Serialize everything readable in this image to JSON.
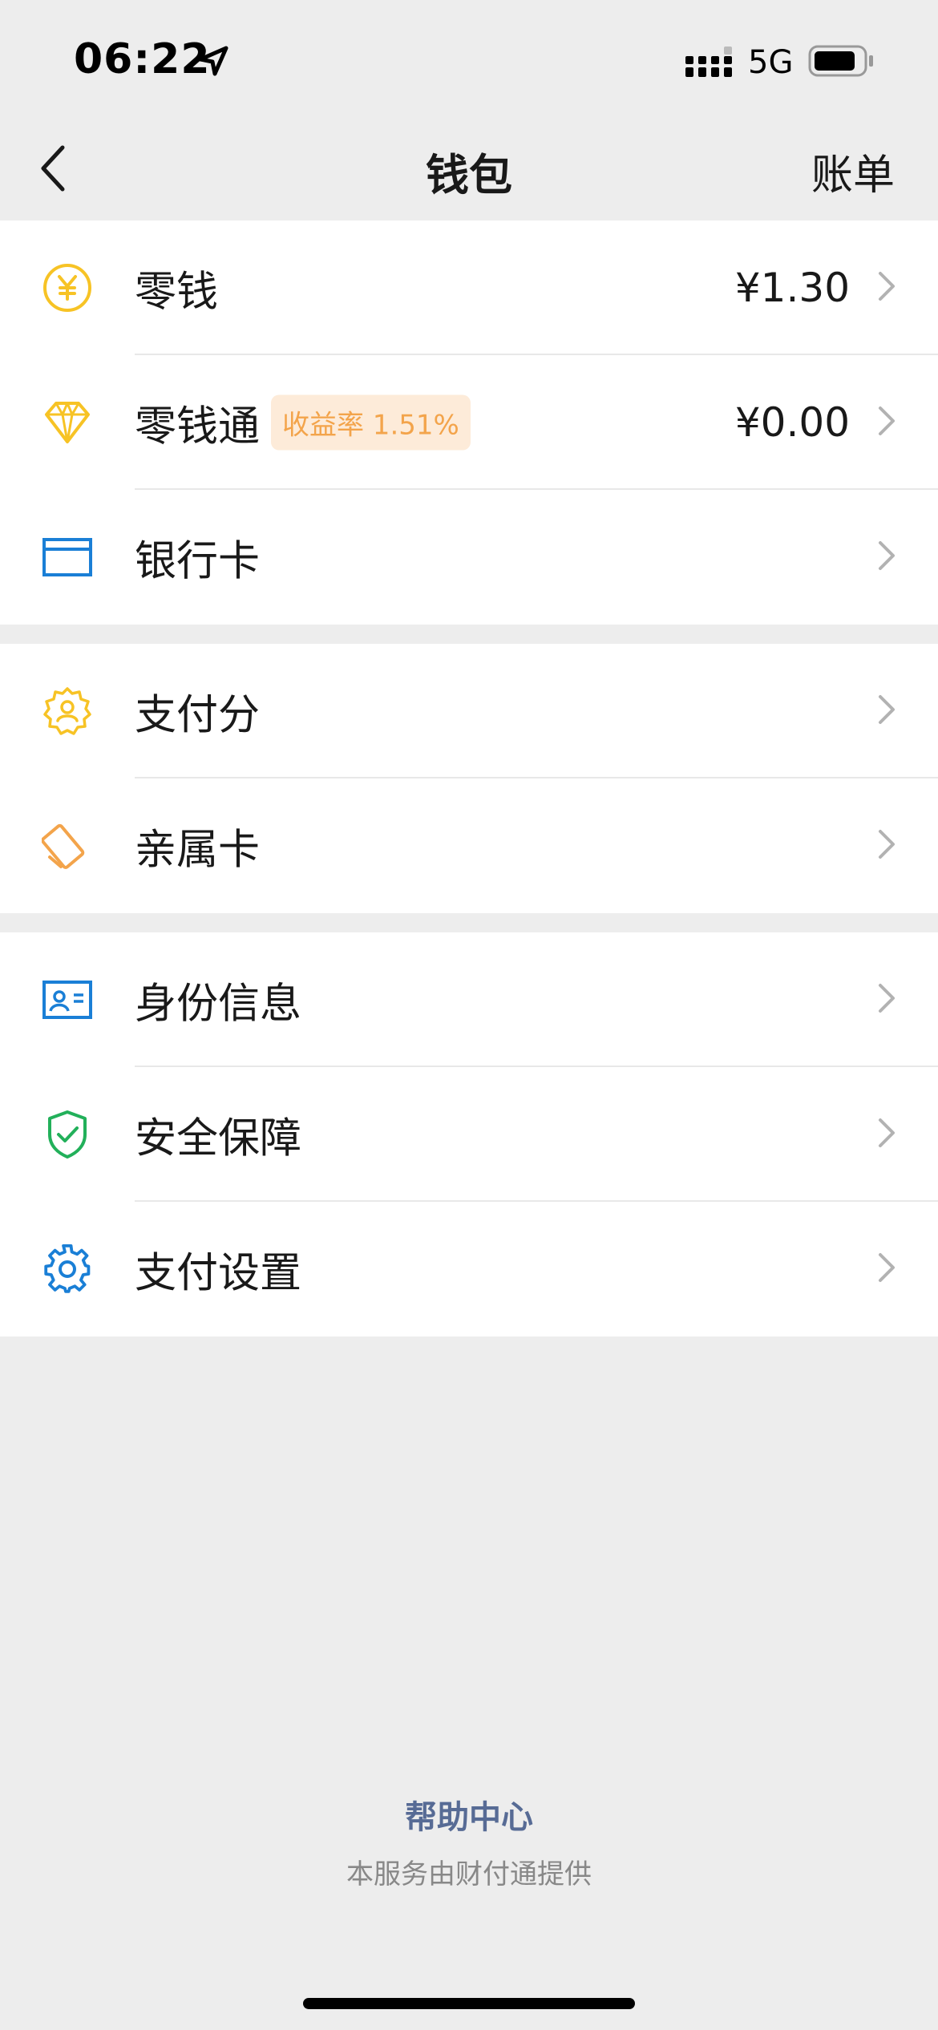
{
  "status_bar": {
    "time": "06:22",
    "network": "5G"
  },
  "nav": {
    "title": "钱包",
    "right_action": "账单"
  },
  "groups": [
    {
      "items": [
        {
          "label": "零钱",
          "value": "¥1.30",
          "icon": "yuan-coin-icon"
        },
        {
          "label": "零钱通",
          "badge": "收益率 1.51%",
          "value": "¥0.00",
          "icon": "diamond-icon"
        },
        {
          "label": "银行卡",
          "icon": "bank-card-icon"
        }
      ]
    },
    {
      "items": [
        {
          "label": "支付分",
          "icon": "pay-score-badge-icon"
        },
        {
          "label": "亲属卡",
          "icon": "family-card-icon"
        }
      ]
    },
    {
      "items": [
        {
          "label": "身份信息",
          "icon": "id-card-icon"
        },
        {
          "label": "安全保障",
          "icon": "shield-check-icon"
        },
        {
          "label": "支付设置",
          "icon": "gear-icon"
        }
      ]
    }
  ],
  "footer": {
    "help": "帮助中心",
    "note": "本服务由财付通提供"
  },
  "colors": {
    "background": "#ededed",
    "card": "#ffffff",
    "yellow": "#f7c325",
    "orange": "#f3a44b",
    "blue": "#1a7fd6",
    "green": "#22b05a",
    "link": "#576b95"
  }
}
